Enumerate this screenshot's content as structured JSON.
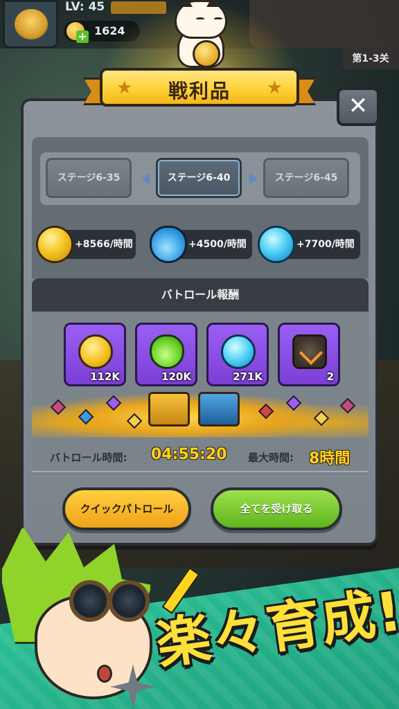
{
  "hud": {
    "level": "LV: 45",
    "gold": "1624",
    "stage_tab": "第1-3关"
  },
  "title": "戦利品",
  "stages": {
    "prev": "ステージ6-35",
    "current": "ステージ6-40",
    "next": "ステージ6-45"
  },
  "rates": [
    {
      "icon": "gold-coin-icon",
      "text": "+8566/時間"
    },
    {
      "icon": "blue-potion-icon",
      "text": "+4500/時間"
    },
    {
      "icon": "blue-orb-icon",
      "text": "+7700/時間"
    }
  ],
  "patrol": {
    "heading": "バトロール報酬",
    "rewards": [
      {
        "icon": "crown-coin-icon",
        "qty": "112K"
      },
      {
        "icon": "green-potion-icon",
        "qty": "120K"
      },
      {
        "icon": "blue-orb-icon",
        "qty": "271K"
      },
      {
        "icon": "emblem-icon",
        "qty": "2"
      }
    ],
    "time_label": "バトロール時間:",
    "time_value": "04:55:20",
    "max_label": "最大時間:",
    "max_value": "8時間"
  },
  "buttons": {
    "quick": "クイックパトロール",
    "claim": "全てを受け取る",
    "close": "✕"
  },
  "promo": {
    "text": "楽々育成!"
  },
  "colors": {
    "banner": "#ffd23a",
    "panel": "#7b838b",
    "reward_tile": "#8a4fe6",
    "quick_button": "#f0a21a",
    "claim_button": "#5fb51d",
    "time_value": "#ffd21f",
    "promo_band": "#2cc79a"
  }
}
